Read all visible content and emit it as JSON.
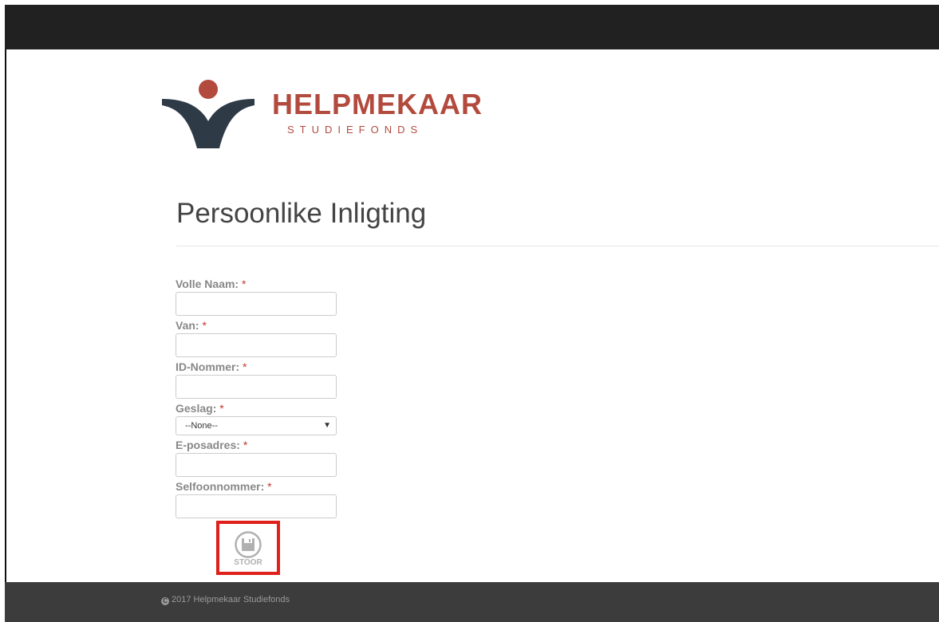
{
  "brand": {
    "name": "HELPMEKAAR",
    "subtitle": "STUDIEFONDS",
    "primary_color": "#b24a3e",
    "dark_color": "#2f3a47"
  },
  "page": {
    "title": "Persoonlike Inligting"
  },
  "form": {
    "required_marker": "*",
    "fields": [
      {
        "label": "Volle Naam:",
        "value": ""
      },
      {
        "label": "Van:",
        "value": ""
      },
      {
        "label": "ID-Nommer:",
        "value": ""
      },
      {
        "label": "Geslag:",
        "selected": "--None--"
      },
      {
        "label": "E-posadres:",
        "value": ""
      },
      {
        "label": "Selfoonnommer:",
        "value": ""
      }
    ],
    "save_label": "STOOR",
    "save_icon": "save-icon"
  },
  "footer": {
    "copyright": "2017 Helpmekaar Studiefonds",
    "copyright_icon": "copyright-icon"
  },
  "colors": {
    "topbar": "#212121",
    "footer": "#3c3c3c",
    "highlight": "#e0201b",
    "required": "#c0392b"
  }
}
